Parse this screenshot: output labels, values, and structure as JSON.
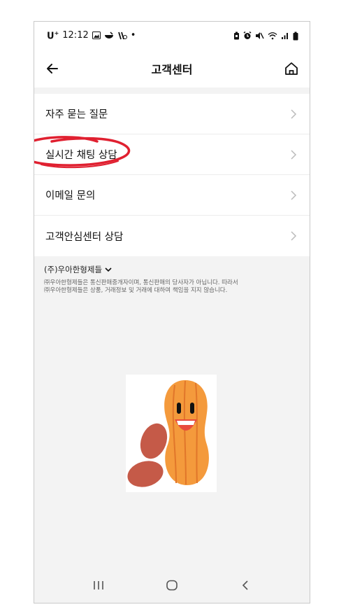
{
  "status_bar": {
    "carrier": "U",
    "carrier_sup": "+",
    "time": "12:12",
    "extra_symbol": "•",
    "icons": [
      "gallery-icon",
      "food-icon",
      "call-muted-icon",
      "battery-saver-icon",
      "alarm-icon",
      "mute-icon",
      "wifi-icon",
      "signal-icon",
      "battery-icon"
    ]
  },
  "header": {
    "title": "고객센터",
    "back_icon": "back-arrow-icon",
    "home_icon": "home-icon"
  },
  "menu": {
    "items": [
      {
        "label": "자주 묻는 질문"
      },
      {
        "label": "실시간 채팅 상담"
      },
      {
        "label": "이메일 문의"
      },
      {
        "label": "고객안심센터 상담"
      }
    ]
  },
  "footer": {
    "company": "(주)우아한형제들",
    "disclaimer_line1": "㈜우아한형제들은 통신판매중개자이며, 통신판매의 당사자가 아닙니다. 따라서",
    "disclaimer_line2": "㈜우아한형제들은 상품, 거래정보 및 거래에 대하여 책임을 지지 않습니다."
  },
  "annotation": {
    "color": "#e02030"
  },
  "colors": {
    "peanut": "#f49a3c",
    "peanut_stripe": "#e1762a",
    "nut": "#c55a48",
    "mouth": "#e84c3d"
  }
}
